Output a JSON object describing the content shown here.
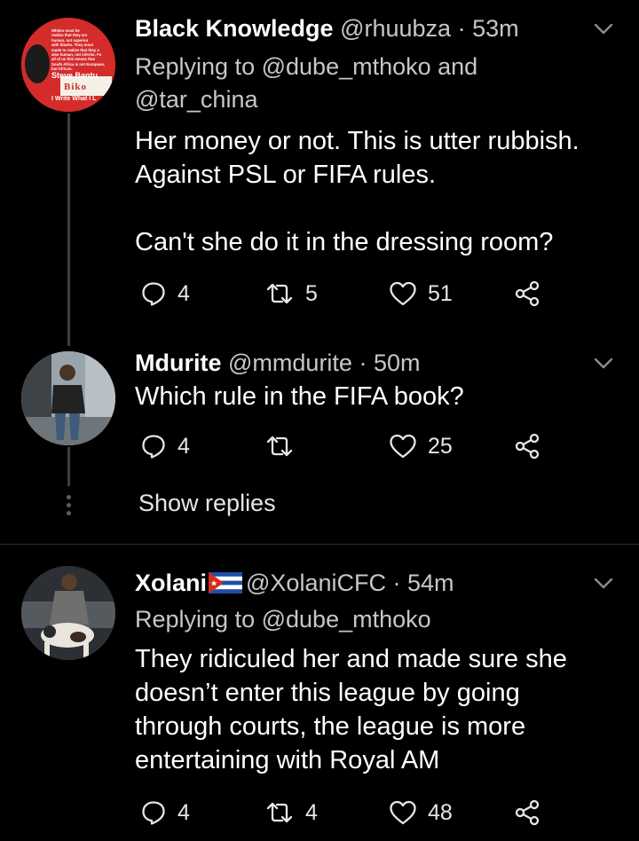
{
  "tweets": [
    {
      "name": "Black Knowledge",
      "handle": "@rhuubza",
      "time": "53m",
      "replying_prefix": "Replying to",
      "replying_line1": "@dube_mthoko and",
      "replying_line2": "@tar_china",
      "text": "Her money or not. This is utter rubbish.\nAgainst PSL or FIFA rules.\n\nCan't she do it in the dressing room?",
      "replies": "4",
      "retweets": "5",
      "likes": "51",
      "avatar": {
        "lines": [
          "Whites must be",
          "realise that they are",
          "human, not superior",
          "with blacks. They must",
          "made to realize that they a",
          "also human, not inferior. Fo",
          "all of us this means that",
          "South Africa is not European,",
          "but African."
        ],
        "author1": "Steve Bantu",
        "author2": "Biko",
        "book": "I Write What I L"
      }
    },
    {
      "name": "Mdurite",
      "handle": "@mmdurite",
      "time": "50m",
      "text": "Which rule in the FIFA book?",
      "replies": "4",
      "retweets": "",
      "likes": "25"
    },
    {
      "name": "Xolani",
      "flag": "cuba-flag",
      "handle": "@XolaniCFC",
      "time": "54m",
      "replying_prefix": "Replying to",
      "replying_line1": "@dube_mthoko",
      "text": "They ridiculed her and made sure she\ndoesn’t enter this league by going\nthrough courts, the league is more\nentertaining with Royal AM",
      "replies": "4",
      "retweets": "4",
      "likes": "48"
    }
  ],
  "show_replies": "Show replies",
  "separator": "·",
  "colors": {
    "background": "#000000",
    "muted": "#c7c7c7",
    "divider": "#2b2f33"
  }
}
